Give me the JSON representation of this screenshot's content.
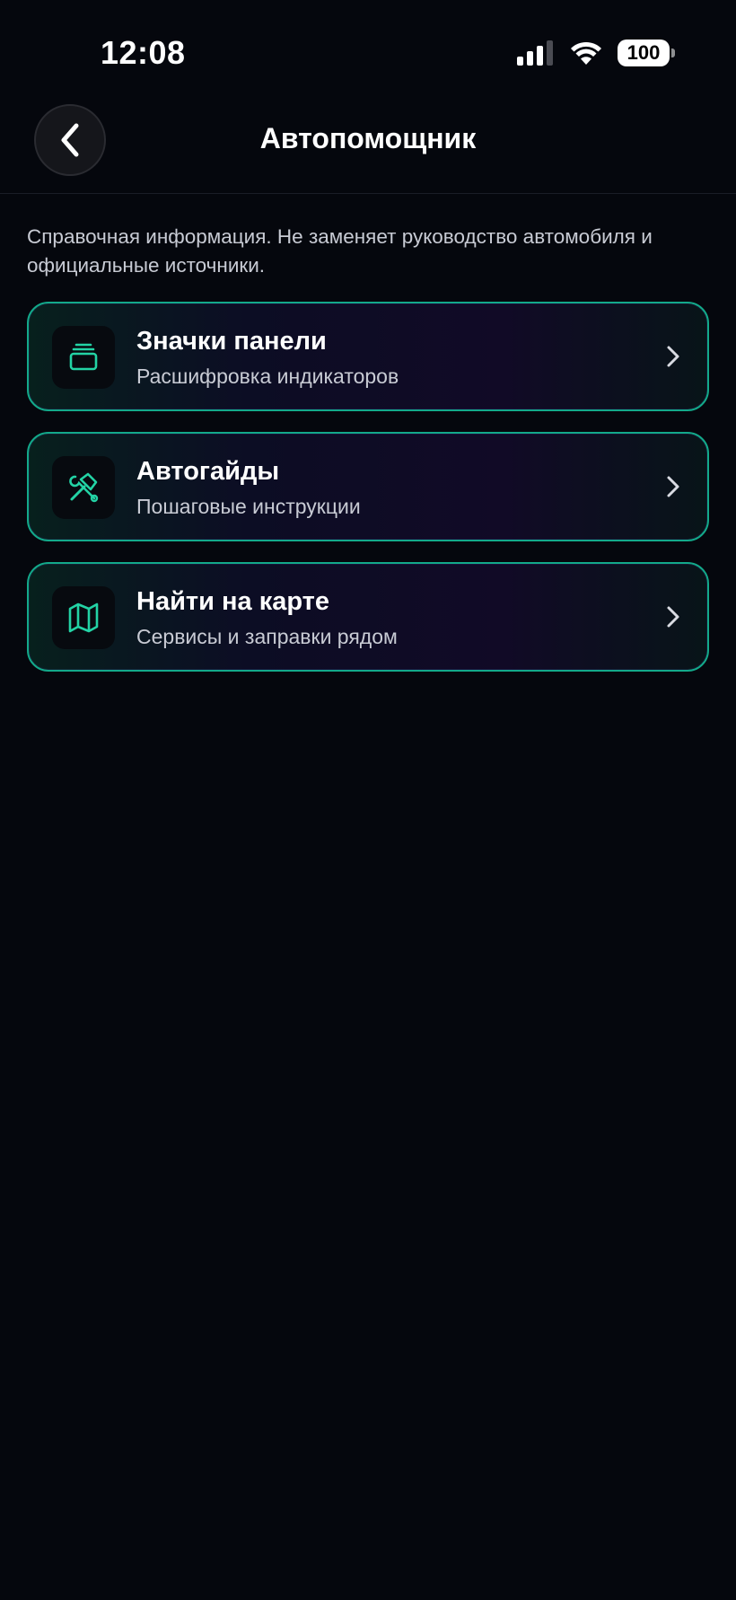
{
  "status": {
    "time": "12:08",
    "battery": "100"
  },
  "header": {
    "title": "Автопомощник"
  },
  "disclaimer": "Справочная информация. Не заменяет руководство автомобиля и официальные источники.",
  "cards": [
    {
      "title": "Значки панели",
      "subtitle": "Расшифровка индикаторов",
      "icon": "dashboard-icon"
    },
    {
      "title": "Автогайды",
      "subtitle": "Пошаговые инструкции",
      "icon": "tools-icon"
    },
    {
      "title": "Найти на карте",
      "subtitle": "Сервисы и заправки рядом",
      "icon": "map-icon"
    }
  ],
  "colors": {
    "background": "#05070d",
    "accent": "#23d3a5",
    "card_border": "#13a98a"
  }
}
